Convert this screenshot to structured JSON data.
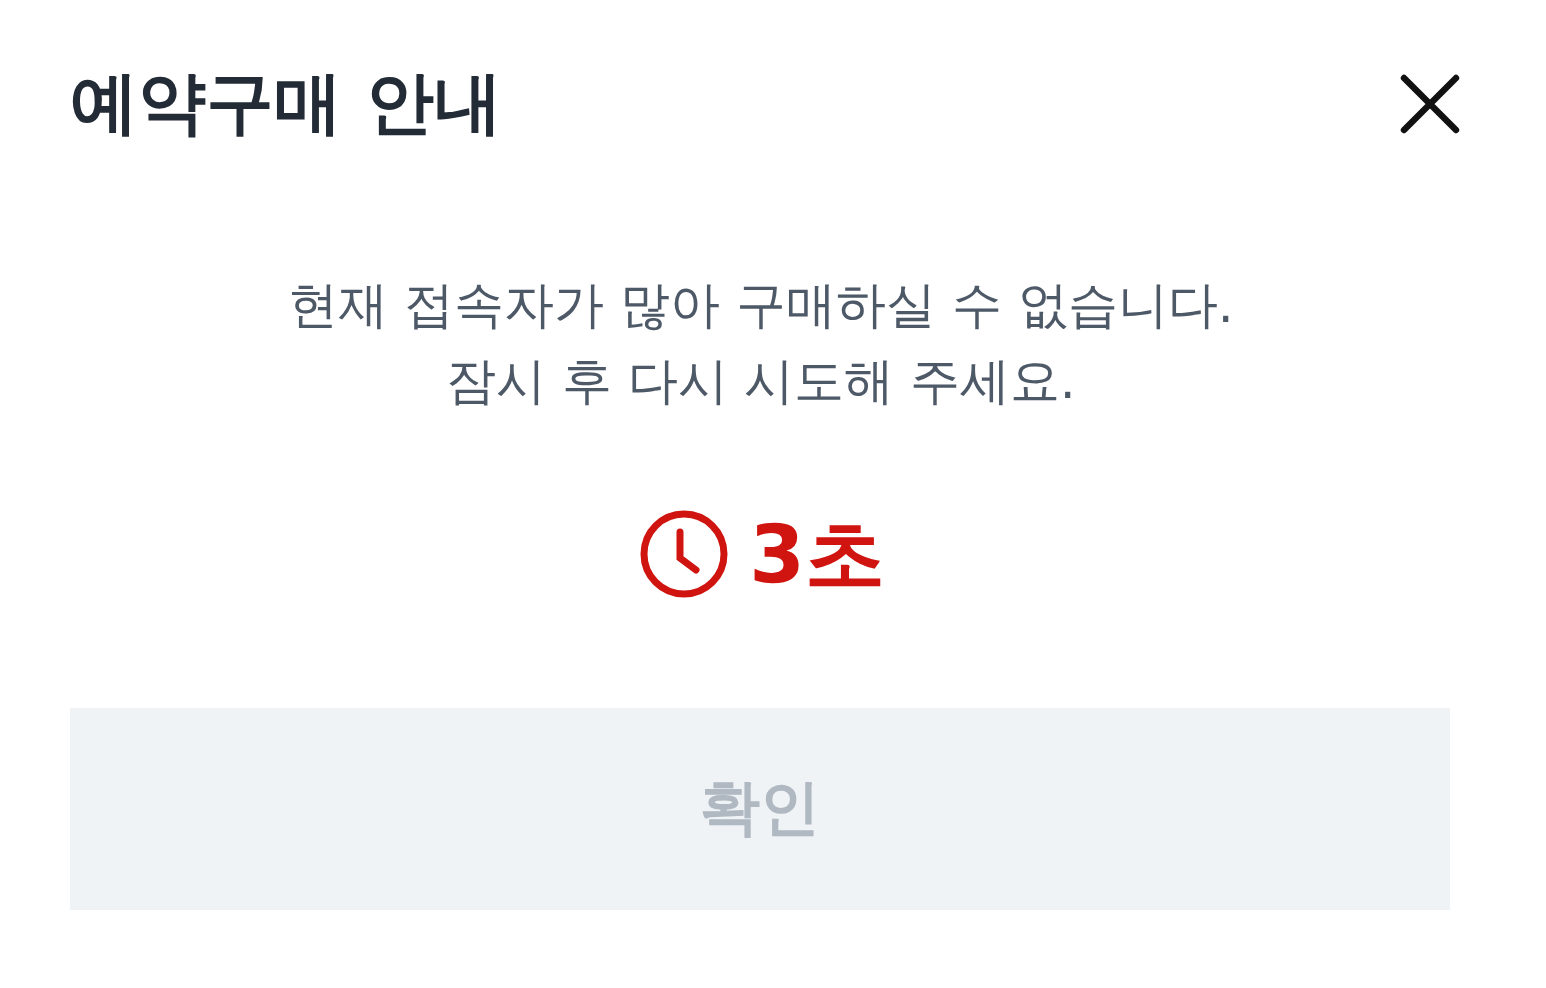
{
  "dialog": {
    "title": "예약구매 안내",
    "message": [
      "현재 접속자가 많아 구매하실 수 없습니다.",
      "잠시 후 다시 시도해 주세요."
    ],
    "countdown": "3초",
    "confirm_button": {
      "label": "확인",
      "disabled": true
    }
  }
}
